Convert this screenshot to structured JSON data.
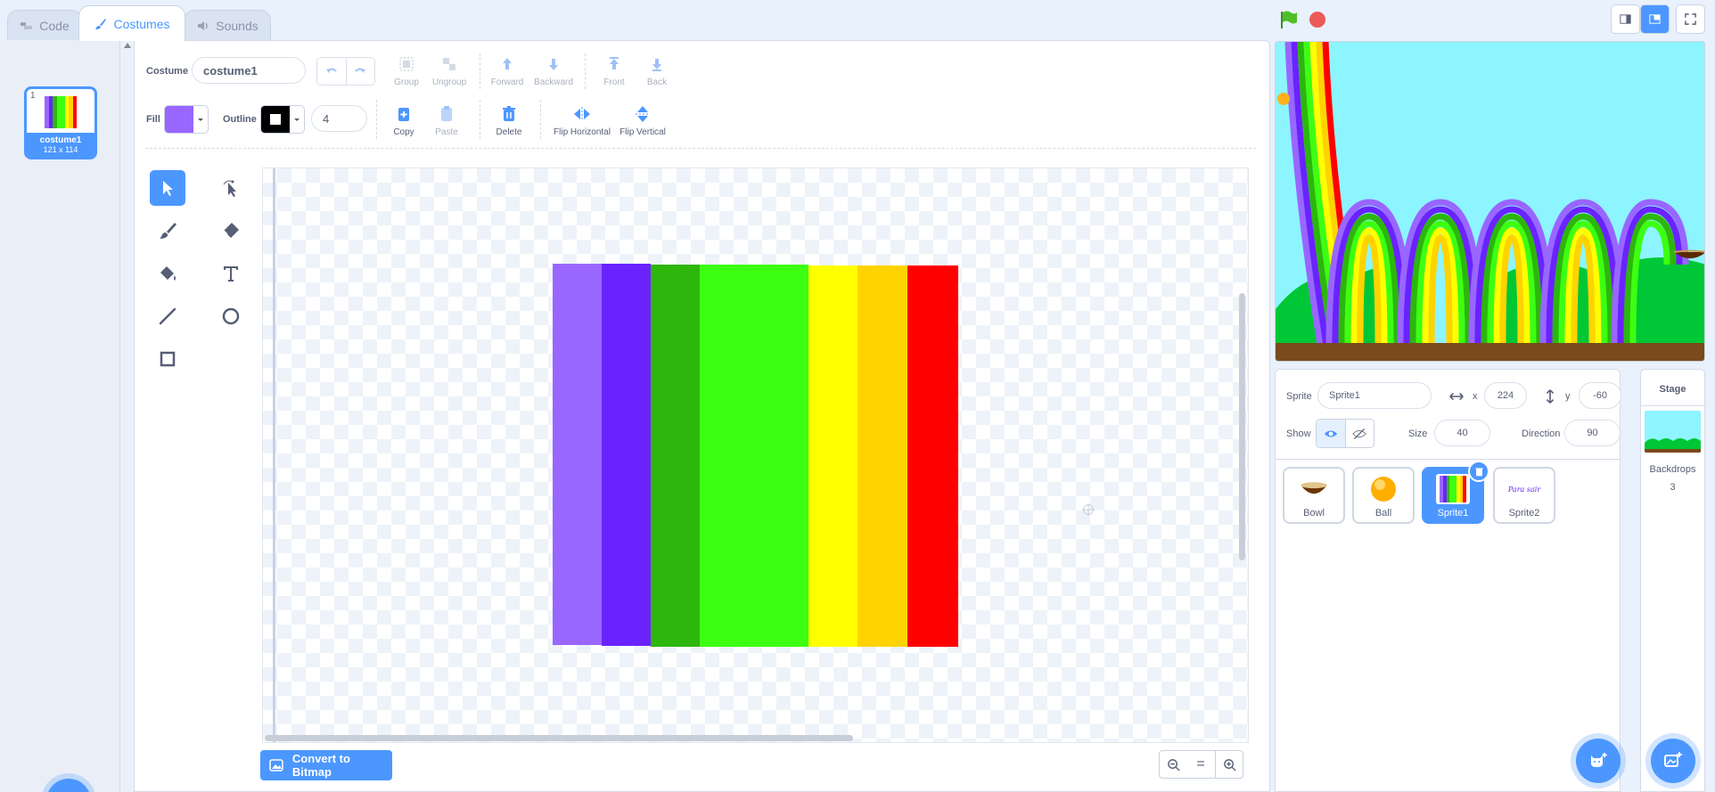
{
  "tabs": {
    "code": "Code",
    "costumes": "Costumes",
    "sounds": "Sounds"
  },
  "costume_list": {
    "index": "1",
    "name": "costume1",
    "size": "121 x 114"
  },
  "toolbar": {
    "costume_label": "Costume",
    "costume_name": "costume1",
    "group": "Group",
    "ungroup": "Ungroup",
    "forward": "Forward",
    "backward": "Backward",
    "front": "Front",
    "back": "Back",
    "fill_label": "Fill",
    "outline_label": "Outline",
    "outline_width": "4",
    "copy": "Copy",
    "paste": "Paste",
    "delete": "Delete",
    "flip_horizontal": "Flip Horizontal",
    "flip_vertical": "Flip Vertical"
  },
  "colors": {
    "accent": "#4c97ff",
    "fill": "#9966ff",
    "outline": "#000000",
    "stripes": [
      "#9966ff",
      "#6a23ff",
      "#2db60c",
      "#3cff12",
      "#ffff00",
      "#ffd300",
      "#ff0000"
    ]
  },
  "tools": [
    "select-icon",
    "reshape-icon",
    "brush-icon",
    "eraser-icon",
    "fill-bucket-icon",
    "text-icon",
    "line-icon",
    "circle-icon",
    "rectangle-icon"
  ],
  "convert_button": "Convert to Bitmap",
  "zoom": {
    "out": "−",
    "reset": "=",
    "in": "+"
  },
  "sprite_info": {
    "sprite_label": "Sprite",
    "sprite_name": "Sprite1",
    "x_label": "x",
    "x_value": "224",
    "y_label": "y",
    "y_value": "-60",
    "show_label": "Show",
    "size_label": "Size",
    "size_value": "40",
    "direction_label": "Direction",
    "direction_value": "90"
  },
  "sprites": [
    {
      "name": "Bowl"
    },
    {
      "name": "Ball"
    },
    {
      "name": "Sprite1"
    },
    {
      "name": "Sprite2",
      "thumb_text": "Para sair"
    }
  ],
  "stage_panel": {
    "title": "Stage",
    "backdrops_label": "Backdrops",
    "backdrops_count": "3"
  }
}
